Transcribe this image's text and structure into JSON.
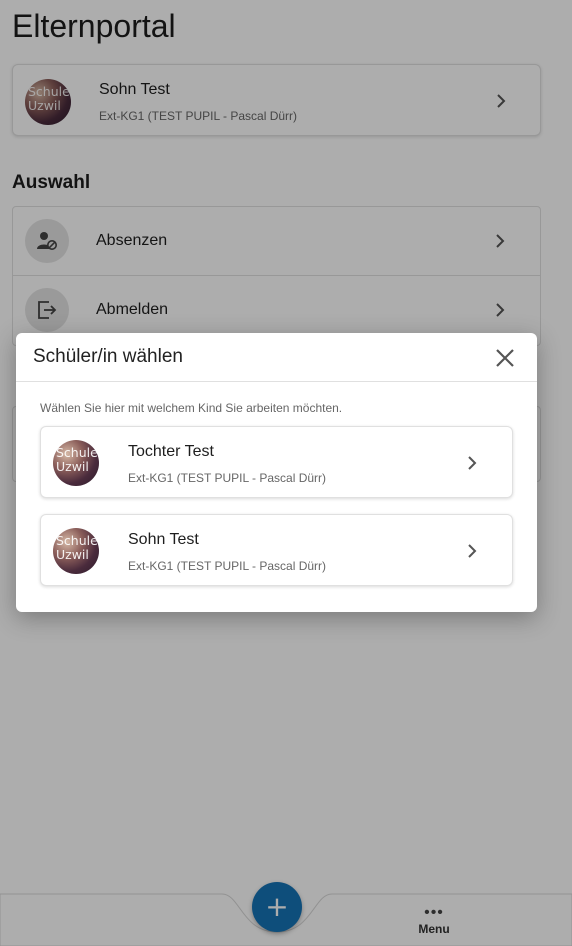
{
  "page": {
    "title": "Elternportal"
  },
  "current_student": {
    "name": "Sohn Test",
    "class": "Ext-KG1 (TEST PUPIL - Pascal Dürr)",
    "avatar_text": [
      "Schule",
      "Uzwil"
    ]
  },
  "auswahl": {
    "title": "Auswahl",
    "items": [
      {
        "label": "Absenzen",
        "icon": "person-block-icon"
      },
      {
        "label": "Abmelden",
        "icon": "logout-icon"
      }
    ]
  },
  "dialog": {
    "title": "Schüler/in wählen",
    "hint": "Wählen Sie hier mit welchem Kind Sie arbeiten möchten.",
    "close_icon": "close-icon",
    "options": [
      {
        "name": "Tochter Test",
        "class": "Ext-KG1 (TEST PUPIL - Pascal Dürr)",
        "avatar_text": [
          "Schule",
          "Uzwil"
        ]
      },
      {
        "name": "Sohn Test",
        "class": "Ext-KG1 (TEST PUPIL - Pascal Dürr)",
        "avatar_text": [
          "Schule",
          "Uzwil"
        ]
      }
    ]
  },
  "bottom_nav": {
    "fab_icon": "plus-icon",
    "fab_symbol": "+",
    "menu_icon": "more-horizontal-icon",
    "menu_dots": "•••",
    "menu_label": "Menu"
  },
  "colors": {
    "accent": "#1673b6",
    "scrim": "rgba(0,0,0,0.32)"
  }
}
